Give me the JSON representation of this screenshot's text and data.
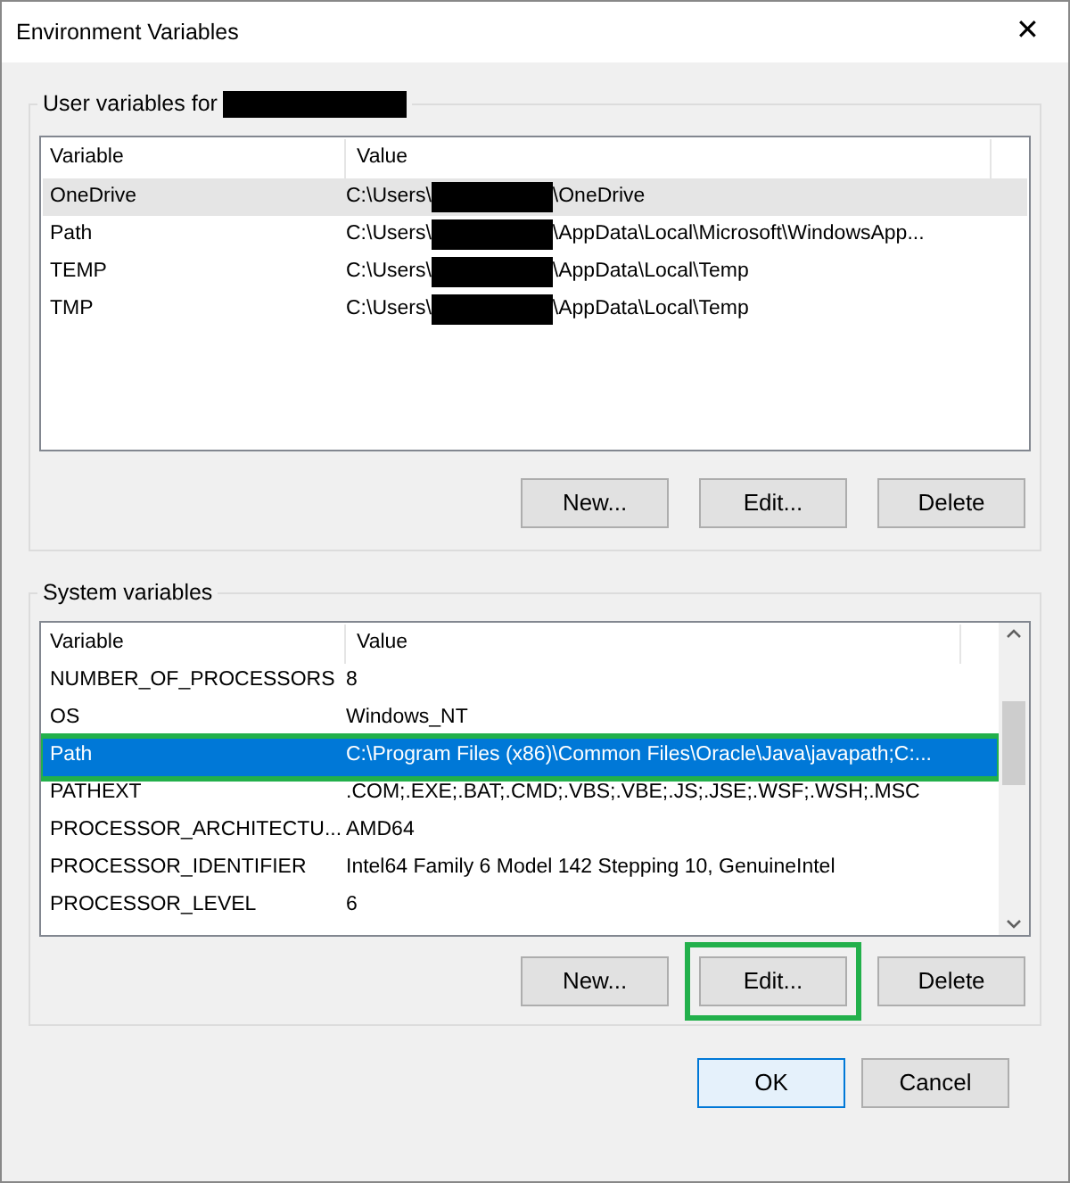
{
  "window": {
    "title": "Environment Variables",
    "close": "✕"
  },
  "user_group": {
    "title": "User variables for",
    "redacted": true,
    "focused": false,
    "columns": [
      "Variable",
      "Value"
    ],
    "rows": [
      {
        "variable": "OneDrive",
        "value_start": "C:\\Users\\",
        "value_end": "\\OneDrive",
        "redacted": true,
        "selected": true,
        "highlighted": false
      },
      {
        "variable": "Path",
        "value_start": "C:\\Users\\",
        "value_end": "\\AppData\\Local\\Microsoft\\WindowsApp...",
        "redacted": true,
        "selected": false,
        "highlighted": false
      },
      {
        "variable": "TEMP",
        "value_start": "C:\\Users\\",
        "value_end": "\\AppData\\Local\\Temp",
        "redacted": true,
        "selected": false,
        "highlighted": false
      },
      {
        "variable": "TMP",
        "value_start": "C:\\Users\\",
        "value_end": "\\AppData\\Local\\Temp",
        "redacted": true,
        "selected": false,
        "highlighted": false
      }
    ],
    "buttons": [
      {
        "label": "New...",
        "highlighted": false
      },
      {
        "label": "Edit...",
        "highlighted": false
      },
      {
        "label": "Delete",
        "highlighted": false
      }
    ]
  },
  "system_group": {
    "title": "System variables",
    "focused": true,
    "columns": [
      "Variable",
      "Value"
    ],
    "rows": [
      {
        "variable": "NUMBER_OF_PROCESSORS",
        "value_start": "8",
        "redacted": false,
        "selected": false,
        "highlighted": false
      },
      {
        "variable": "OS",
        "value_start": "Windows_NT",
        "redacted": false,
        "selected": false,
        "highlighted": false
      },
      {
        "variable": "Path",
        "value_start": "C:\\Program Files (x86)\\Common Files\\Oracle\\Java\\javapath;C:...",
        "redacted": false,
        "selected": true,
        "highlighted": true
      },
      {
        "variable": "PATHEXT",
        "value_start": ".COM;.EXE;.BAT;.CMD;.VBS;.VBE;.JS;.JSE;.WSF;.WSH;.MSC",
        "redacted": false,
        "selected": false,
        "highlighted": false
      },
      {
        "variable": "PROCESSOR_ARCHITECTU...",
        "value_start": "AMD64",
        "redacted": false,
        "selected": false,
        "highlighted": false
      },
      {
        "variable": "PROCESSOR_IDENTIFIER",
        "value_start": "Intel64 Family 6 Model 142 Stepping 10, GenuineIntel",
        "redacted": false,
        "selected": false,
        "highlighted": false
      },
      {
        "variable": "PROCESSOR_LEVEL",
        "value_start": "6",
        "redacted": false,
        "selected": false,
        "highlighted": false
      }
    ],
    "buttons": [
      {
        "label": "New...",
        "highlighted": false
      },
      {
        "label": "Edit...",
        "highlighted": true
      },
      {
        "label": "Delete",
        "highlighted": false
      }
    ]
  },
  "footer_buttons": [
    {
      "label": "OK",
      "default": true
    },
    {
      "label": "Cancel",
      "default": false
    }
  ]
}
